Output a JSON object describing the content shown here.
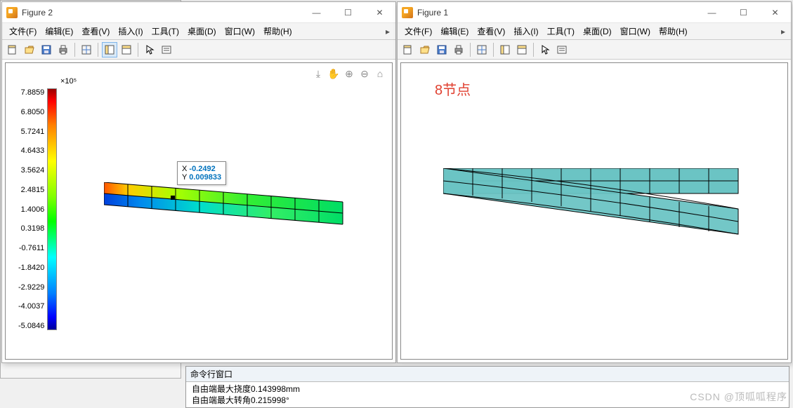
{
  "figure2": {
    "title": "Figure 2",
    "menus": [
      "文件(F)",
      "编辑(E)",
      "查看(V)",
      "插入(I)",
      "工具(T)",
      "桌面(D)",
      "窗口(W)",
      "帮助(H)"
    ],
    "toolbar_icons": [
      "new-file",
      "open-file",
      "save",
      "print",
      "sep",
      "inspect",
      "sep",
      "dock-1",
      "dock-2",
      "sep",
      "pointer",
      "brush"
    ],
    "plot_tools": [
      "forward-icon",
      "pan-icon",
      "zoom-in-icon",
      "zoom-out-icon",
      "home-icon"
    ],
    "window_controls": {
      "min": "—",
      "max": "☐",
      "close": "✕"
    },
    "colorbar_exponent": "×10⁵",
    "colorbar_ticks": [
      "7.8859",
      "6.8050",
      "5.7241",
      "4.6433",
      "3.5624",
      "2.4815",
      "1.4006",
      "0.3198",
      "-0.7611",
      "-1.8420",
      "-2.9229",
      "-4.0037",
      "-5.0846"
    ],
    "datatip": {
      "xlabel": "X",
      "xval": "-0.2492",
      "ylabel": "Y",
      "yval": "0.009833"
    }
  },
  "figure1": {
    "title": "Figure 1",
    "menus": [
      "文件(F)",
      "编辑(E)",
      "查看(V)",
      "插入(I)",
      "工具(T)",
      "桌面(D)",
      "窗口(W)",
      "帮助(H)"
    ],
    "toolbar_icons": [
      "new-file",
      "open-file",
      "save",
      "print",
      "sep",
      "inspect",
      "sep",
      "dock-1",
      "dock-2",
      "sep",
      "pointer",
      "brush"
    ],
    "window_controls": {
      "min": "—",
      "max": "☐",
      "close": "✕"
    },
    "annotation": "8节点"
  },
  "command_window": {
    "title": "命令行窗口",
    "lines": [
      "自由端最大挠度0.143998mm",
      "自由端最大转角0.215998°"
    ]
  },
  "watermark": "CSDN @顶呱呱程序",
  "icon_glyphs": {
    "new-file": "▭",
    "open-file": "📂",
    "save": "💾",
    "print": "🖨",
    "inspect": "🗎",
    "dock-1": "⊞",
    "dock-2": "⊟",
    "pointer": "↖",
    "brush": "▤"
  },
  "chart_data": [
    {
      "type": "heatmap",
      "title": "",
      "description": "2×10 FEM mesh of a cantilever beam, deformed, colored by stress (jet colormap)",
      "xlabel": "",
      "ylabel": "",
      "colorbar_label": "×10⁵",
      "value_range": [
        -5.0846,
        7.8859
      ],
      "colorbar_ticks": [
        7.8859,
        6.805,
        5.7241,
        4.6433,
        3.5624,
        2.4815,
        1.4006,
        0.3198,
        -0.7611,
        -1.842,
        -2.9229,
        -4.0037,
        -5.0846
      ],
      "datatip": {
        "x": -0.2492,
        "y": 0.009833
      },
      "grid": {
        "rows": 2,
        "cols": 10
      }
    },
    {
      "type": "other",
      "description": "2×10 FEM mesh of a cantilever beam, undeformed + deformed overlay, uniform teal fill",
      "annotation": "8节点",
      "grid": {
        "rows": 2,
        "cols": 10
      }
    }
  ]
}
